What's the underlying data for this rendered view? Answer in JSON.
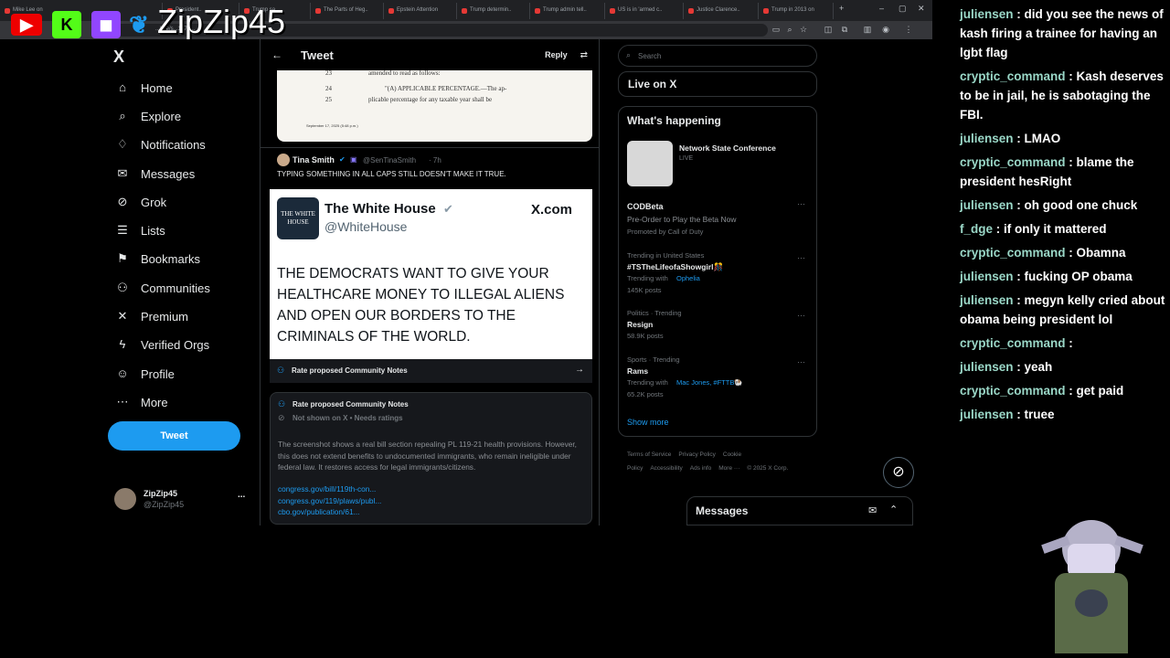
{
  "browser": {
    "tabs": [
      "Mike Lee on",
      "President..",
      "Trump sa..",
      "The Parts of Heg..",
      "Epstein Attention",
      "Trump determin..",
      "Trump admin tell..",
      "US is in 'armed c..",
      "Justice Clarence..",
      "Trump in 2013 on"
    ],
    "url": "...Lee/s...1978...",
    "new_tab": "+"
  },
  "overlay": {
    "brand": "ZipZip45"
  },
  "nav": {
    "logo": "X",
    "items": [
      {
        "label": "Home",
        "icon": "home-icon",
        "glyph": "⌂"
      },
      {
        "label": "Explore",
        "icon": "search-icon",
        "glyph": "⌕"
      },
      {
        "label": "Notifications",
        "icon": "bell-icon",
        "glyph": "♢"
      },
      {
        "label": "Messages",
        "icon": "mail-icon",
        "glyph": "✉"
      },
      {
        "label": "Grok",
        "icon": "grok-icon",
        "glyph": "⊘"
      },
      {
        "label": "Lists",
        "icon": "list-icon",
        "glyph": "☰"
      },
      {
        "label": "Bookmarks",
        "icon": "bookmark-icon",
        "glyph": "⚑"
      },
      {
        "label": "Communities",
        "icon": "people-icon",
        "glyph": "⚇"
      },
      {
        "label": "Premium",
        "icon": "x-icon",
        "glyph": "✕"
      },
      {
        "label": "Verified Orgs",
        "icon": "lightning-icon",
        "glyph": "ϟ"
      },
      {
        "label": "Profile",
        "icon": "person-icon",
        "glyph": "☺"
      },
      {
        "label": "More",
        "icon": "more-icon",
        "glyph": "⋯"
      }
    ],
    "tweet_button": "Tweet",
    "account": {
      "name": "ZipZip45",
      "handle": "@ZipZip45",
      "more": "..."
    }
  },
  "center": {
    "header_title": "Tweet",
    "reply": "Reply",
    "doc_lines": [
      {
        "num": "23",
        "text": "amended to read as follows:"
      },
      {
        "num": "24",
        "text": "\"(A) APPLICABLE PERCENTAGE.—The ap-"
      },
      {
        "num": "25",
        "text": "plicable percentage for any taxable year shall be"
      }
    ],
    "doc_date": "September 17, 2025 (5:48 p.m.)",
    "tweet": {
      "name": "Tina Smith",
      "handle": "@SenTinaSmith",
      "time": "· 7h",
      "text": "TYPING SOMETHING IN ALL CAPS STILL DOESN'T MAKE IT TRUE."
    },
    "embed": {
      "logo_text": "THE WHITE HOUSE",
      "name": "The White House",
      "handle": "@WhiteHouse",
      "site": "X.com",
      "text": "THE DEMOCRATS WANT TO GIVE YOUR HEALTHCARE MONEY TO ILLEGAL ALIENS AND OPEN OUR BORDERS TO THE CRIMINALS OF THE WORLD."
    },
    "rate_bar": "Rate proposed Community Notes",
    "note": {
      "title": "Rate proposed Community Notes",
      "status": "Not shown on X • Needs ratings",
      "body": "The screenshot shows a real bill section repealing PL 119-21 health provisions. However, this does not extend benefits to undocumented immigrants, who remain ineligible under federal law. It restores access for legal immigrants/citizens.",
      "links": [
        "congress.gov/bill/119th-con...",
        "congress.gov/119/plaws/publ...",
        "cbo.gov/publication/61..."
      ]
    }
  },
  "right": {
    "search_placeholder": "Search",
    "live": "Live on X",
    "happening": "What's happening",
    "conference": {
      "title": "Network State Conference",
      "status": "LIVE"
    },
    "promo": {
      "title": "CODBeta",
      "line": "Pre-Order to Play the Beta Now",
      "by": "Promoted by Call of Duty"
    },
    "trends": [
      {
        "ctx": "Trending in United States",
        "name": "#TSTheLifeofaShowgirl🎊",
        "with_label": "Trending with",
        "with": "Ophelia",
        "posts": "145K posts"
      },
      {
        "ctx": "Politics · Trending",
        "name": "Resign",
        "with_label": "",
        "with": "",
        "posts": "58.9K posts"
      },
      {
        "ctx": "Sports · Trending",
        "name": "Rams",
        "with_label": "Trending with",
        "with": "Mac Jones, #FTTB🐏",
        "posts": "65.2K posts"
      }
    ],
    "show_more": "Show more",
    "footer": [
      "Terms of Service",
      "Privacy Policy",
      "Cookie Policy",
      "Accessibility",
      "Ads info",
      "More ···",
      "© 2025 X Corp."
    ],
    "messages": "Messages"
  },
  "chat": [
    {
      "user": "juliensen",
      "msg": "did you see the news of kash firing a trainee for having an lgbt flag",
      "color": "#9ad7c7"
    },
    {
      "user": "cryptic_command",
      "msg": "Kash deserves to be in jail, he is sabotaging the FBI.",
      "color": "#9ad7c7"
    },
    {
      "user": "juliensen",
      "msg": "LMAO",
      "color": "#9ad7c7"
    },
    {
      "user": "cryptic_command",
      "msg": "blame the president hesRight",
      "color": "#9ad7c7"
    },
    {
      "user": "juliensen",
      "msg": "oh good one chuck",
      "color": "#9ad7c7"
    },
    {
      "user": "f_dge",
      "msg": "if only it mattered",
      "color": "#9ad7c7"
    },
    {
      "user": "cryptic_command",
      "msg": "Obamna",
      "color": "#9ad7c7"
    },
    {
      "user": "juliensen",
      "msg": "fucking OP obama",
      "color": "#9ad7c7"
    },
    {
      "user": "juliensen",
      "msg": "megyn kelly cried about obama being president lol",
      "color": "#9ad7c7"
    },
    {
      "user": "cryptic_command",
      "msg": "",
      "color": "#9ad7c7"
    },
    {
      "user": "juliensen",
      "msg": "yeah",
      "color": "#9ad7c7"
    },
    {
      "user": "cryptic_command",
      "msg": "get paid",
      "color": "#9ad7c7"
    },
    {
      "user": "juliensen",
      "msg": "truee",
      "color": "#9ad7c7"
    }
  ]
}
